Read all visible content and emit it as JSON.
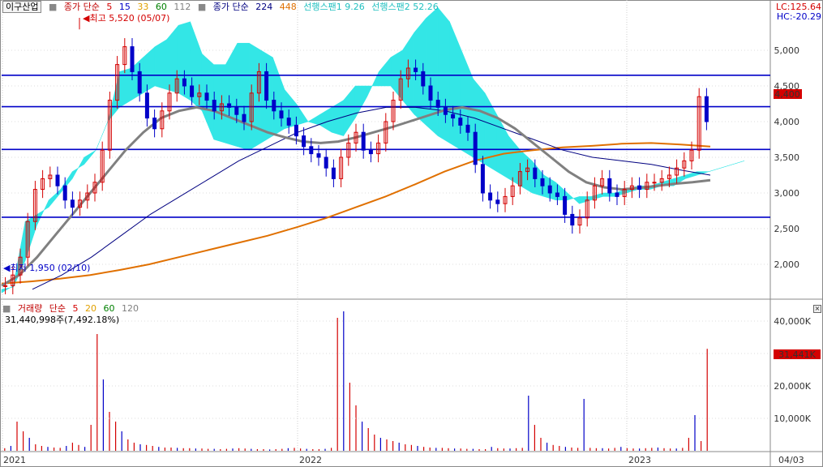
{
  "header": {
    "stock_name": "이구산업",
    "ma_label": "종가 단순",
    "ma_periods": [
      "5",
      "15",
      "33",
      "60",
      "112"
    ],
    "ma_colors": [
      "#d40000",
      "#0000c8",
      "#e0a000",
      "#008000",
      "#808080"
    ],
    "long_ma_label": "종가 단순",
    "long_ma_periods": [
      "224",
      "448"
    ],
    "long_ma_colors": [
      "#000080",
      "#e07000"
    ],
    "span1": "선행스팬1 9.26",
    "span2": "선행스팬2 52.26",
    "lc": "LC:125.64",
    "hc": "HC:-20.29"
  },
  "volume_header": {
    "label": "거래량",
    "ma_label": "단순",
    "ma_periods": [
      "5",
      "20",
      "60",
      "120"
    ],
    "ma_colors": [
      "#d40000",
      "#e0a000",
      "#008000",
      "#808080"
    ],
    "value": "31,440,998주(7,492.18%)"
  },
  "price_tag": "4,400",
  "volume_tag": "31,441K",
  "colors": {
    "up": "#d40000",
    "down": "#0000c8",
    "cloud": "#33e6e6",
    "h_lines": "#0000c8",
    "ma224": "#000080",
    "ma448": "#e07000",
    "ma112": "#808080"
  },
  "chart_data": [
    {
      "type": "line",
      "title": "",
      "y_ticks": [
        "2,000",
        "2,500",
        "3,000",
        "3,500",
        "4,000",
        "4,500",
        "5,000"
      ],
      "ylim": [
        1550,
        5850
      ],
      "x_ticks": [
        "2021",
        "2022",
        "2023",
        "04/03"
      ],
      "annotations": [
        {
          "text": "최고 5,520 (05/07)",
          "value": 5520
        },
        {
          "text": "최저 1,950 (02/10)",
          "value": 1950
        }
      ],
      "horizontal_lines": [
        4650,
        4210,
        3610,
        2660
      ],
      "close_series": [
        1700,
        1850,
        2100,
        2600,
        3050,
        3200,
        3250,
        3100,
        2900,
        2800,
        2900,
        3000,
        3150,
        3600,
        4300,
        4800,
        5050,
        4700,
        4400,
        4050,
        3900,
        4150,
        4400,
        4600,
        4500,
        4350,
        4400,
        4300,
        4150,
        4250,
        4200,
        4100,
        4000,
        4400,
        4700,
        4300,
        4150,
        4050,
        3950,
        3800,
        3650,
        3550,
        3500,
        3350,
        3200,
        3500,
        3700,
        3850,
        3600,
        3550,
        3700,
        4000,
        4300,
        4600,
        4750,
        4700,
        4500,
        4300,
        4200,
        4100,
        4050,
        3950,
        3850,
        3400,
        3000,
        2900,
        2850,
        2950,
        3100,
        3300,
        3350,
        3200,
        3100,
        3000,
        2950,
        2700,
        2550,
        2650,
        2900,
        3100,
        3200,
        3000,
        2950,
        3050,
        3100,
        3050,
        3150,
        3150,
        3200,
        3250,
        3350,
        3450,
        3600,
        4350,
        4000
      ],
      "series": [
        {
          "name": "선행스팬1",
          "values": [
            1650,
            1680,
            2050,
            2550,
            2900,
            3050,
            3300,
            3400,
            3600,
            4000,
            4700,
            4750,
            4900,
            5050,
            5150,
            5350,
            5400,
            4950,
            4800,
            4800,
            5100,
            5100,
            5000,
            4900,
            4450,
            4250,
            4000,
            3950,
            3850,
            3800,
            4050,
            4350,
            4700,
            4900,
            5000,
            5250,
            5450,
            5600,
            5400,
            5000,
            4600,
            4400,
            4100,
            3800,
            3600,
            3450,
            3250,
            3150,
            3000,
            2850,
            2900,
            2950,
            2950,
            3000,
            3050,
            3050,
            3100,
            3100,
            3200,
            3250,
            3300,
            3350,
            3400,
            3450
          ]
        },
        {
          "name": "선행스팬2",
          "values": [
            1600,
            1700,
            2600,
            2700,
            2800,
            3000,
            3200,
            3500,
            3600,
            4000,
            4200,
            4300,
            4400,
            4500,
            4450,
            4400,
            4300,
            4150,
            3750,
            3700,
            3650,
            3600,
            3700,
            3800,
            3900,
            3950,
            4000,
            4100,
            4200,
            4300,
            4500,
            4500,
            4500,
            4500,
            4300,
            4100,
            3950,
            3800,
            3700,
            3600,
            3500,
            3400,
            3300,
            3200,
            3100,
            3000,
            2950,
            2900,
            2900,
            2950,
            2950,
            3000,
            3000,
            3050,
            3100,
            3100,
            3150,
            3200,
            3250,
            3300,
            3300,
            3350,
            3400,
            3450
          ]
        },
        {
          "name": "MA112",
          "values": [
            1700,
            1850,
            2100,
            2400,
            2700,
            3000,
            3300,
            3600,
            3850,
            4050,
            4150,
            4200,
            4150,
            4050,
            3950,
            3850,
            3780,
            3720,
            3700,
            3720,
            3780,
            3850,
            3920,
            4000,
            4080,
            4160,
            4200,
            4150,
            4050,
            3900,
            3700,
            3500,
            3300,
            3150,
            3080,
            3050,
            3070,
            3100,
            3130,
            3150,
            3180
          ]
        },
        {
          "name": "MA224",
          "values": [
            1650,
            1850,
            2100,
            2400,
            2700,
            2950,
            3200,
            3450,
            3650,
            3850,
            4000,
            4120,
            4200,
            4200,
            4150,
            4050,
            3900,
            3750,
            3600,
            3500,
            3450,
            3400,
            3320,
            3250
          ]
        },
        {
          "name": "MA448",
          "values": [
            1730,
            1760,
            1800,
            1850,
            1920,
            2000,
            2100,
            2200,
            2300,
            2400,
            2520,
            2650,
            2800,
            2950,
            3120,
            3300,
            3450,
            3550,
            3600,
            3640,
            3660,
            3690,
            3700,
            3680,
            3650
          ]
        }
      ]
    },
    {
      "type": "bar",
      "title": "",
      "y_ticks": [
        "10,000K",
        "20,000K",
        "30,000K",
        "40,000K"
      ],
      "ylim": [
        0,
        48000
      ],
      "values_k": [
        800,
        1500,
        9000,
        6000,
        4000,
        2000,
        1500,
        1200,
        1000,
        900,
        1500,
        2500,
        1800,
        1200,
        8000,
        36000,
        22000,
        12000,
        9000,
        6000,
        3500,
        2500,
        2000,
        1800,
        1500,
        1200,
        1000,
        1000,
        900,
        800,
        800,
        700,
        700,
        600,
        600,
        500,
        600,
        700,
        800,
        700,
        600,
        500,
        500,
        400,
        500,
        600,
        800,
        900,
        700,
        600,
        500,
        500,
        600,
        900,
        41000,
        43000,
        21000,
        14000,
        9000,
        7000,
        5000,
        4000,
        3500,
        3000,
        2500,
        2000,
        1800,
        1500,
        1200,
        1000,
        900,
        900,
        800,
        700,
        700,
        600,
        600,
        500,
        500,
        1200,
        800,
        700,
        700,
        800,
        900,
        17000,
        8000,
        4000,
        2500,
        1800,
        1500,
        1200,
        1000,
        900,
        16000,
        900,
        800,
        800,
        700,
        900,
        1200,
        800,
        700,
        700,
        800,
        900,
        1000,
        800,
        700,
        700,
        900,
        4000,
        11000,
        3000,
        31441
      ]
    }
  ]
}
